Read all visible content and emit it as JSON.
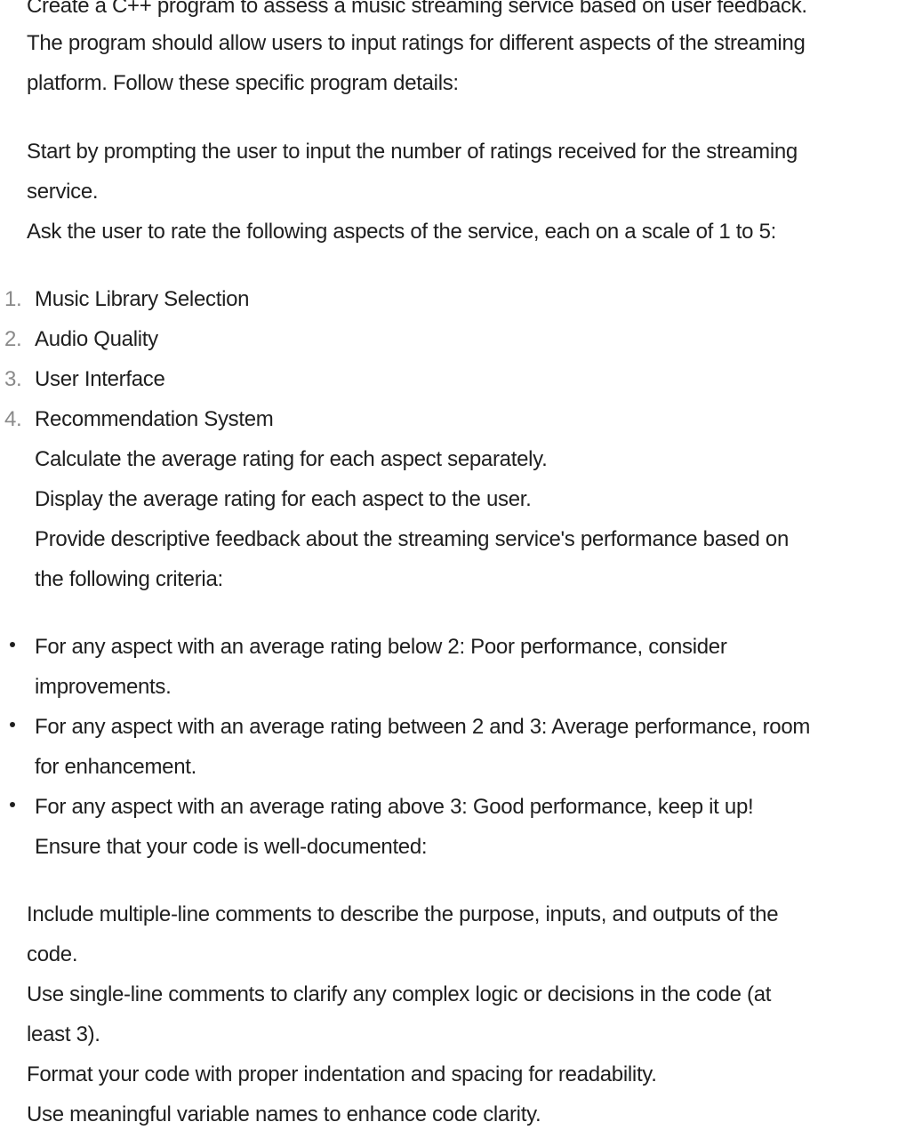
{
  "intro": {
    "line1": "Create a C++ program to assess a music streaming service based on user feedback.",
    "line2": "The program should allow users to input ratings for different aspects of the streaming",
    "line3": "platform. Follow these specific program details:"
  },
  "step1": {
    "line1": "Start by prompting the user to input the number of ratings received for the streaming",
    "line2": "service."
  },
  "step2": "Ask the user to rate the following aspects of the service, each on a scale of 1 to 5:",
  "aspects": [
    {
      "number": "1.",
      "label": "Music Library Selection"
    },
    {
      "number": "2.",
      "label": "Audio Quality"
    },
    {
      "number": "3.",
      "label": "User Interface"
    },
    {
      "number": "4.",
      "label": "Recommendation System"
    }
  ],
  "sub_steps": {
    "calc": "Calculate the average rating for each aspect separately.",
    "display": "Display the average rating for each aspect to the user.",
    "feedback_line1": "Provide descriptive feedback about the streaming service's performance based on",
    "feedback_line2": "the following criteria:"
  },
  "criteria": [
    {
      "line1": "For any aspect with an average rating below 2: Poor performance, consider",
      "line2": "improvements."
    },
    {
      "line1": "For any aspect with an average rating between 2 and 3: Average performance, room",
      "line2": "for enhancement."
    },
    {
      "line1": "For any aspect with an average rating above 3: Good performance, keep it up!"
    }
  ],
  "documentation_heading": "Ensure that your code is well-documented:",
  "documentation": {
    "multi_line1": "Include multiple-line comments to describe the purpose, inputs, and outputs of the",
    "multi_line2": "code.",
    "single_line1": "Use single-line comments to clarify any complex logic or decisions in the code (at",
    "single_line2": "least 3).",
    "format": "Format your code with proper indentation and spacing for readability.",
    "names": "Use meaningful variable names to enhance code clarity."
  }
}
